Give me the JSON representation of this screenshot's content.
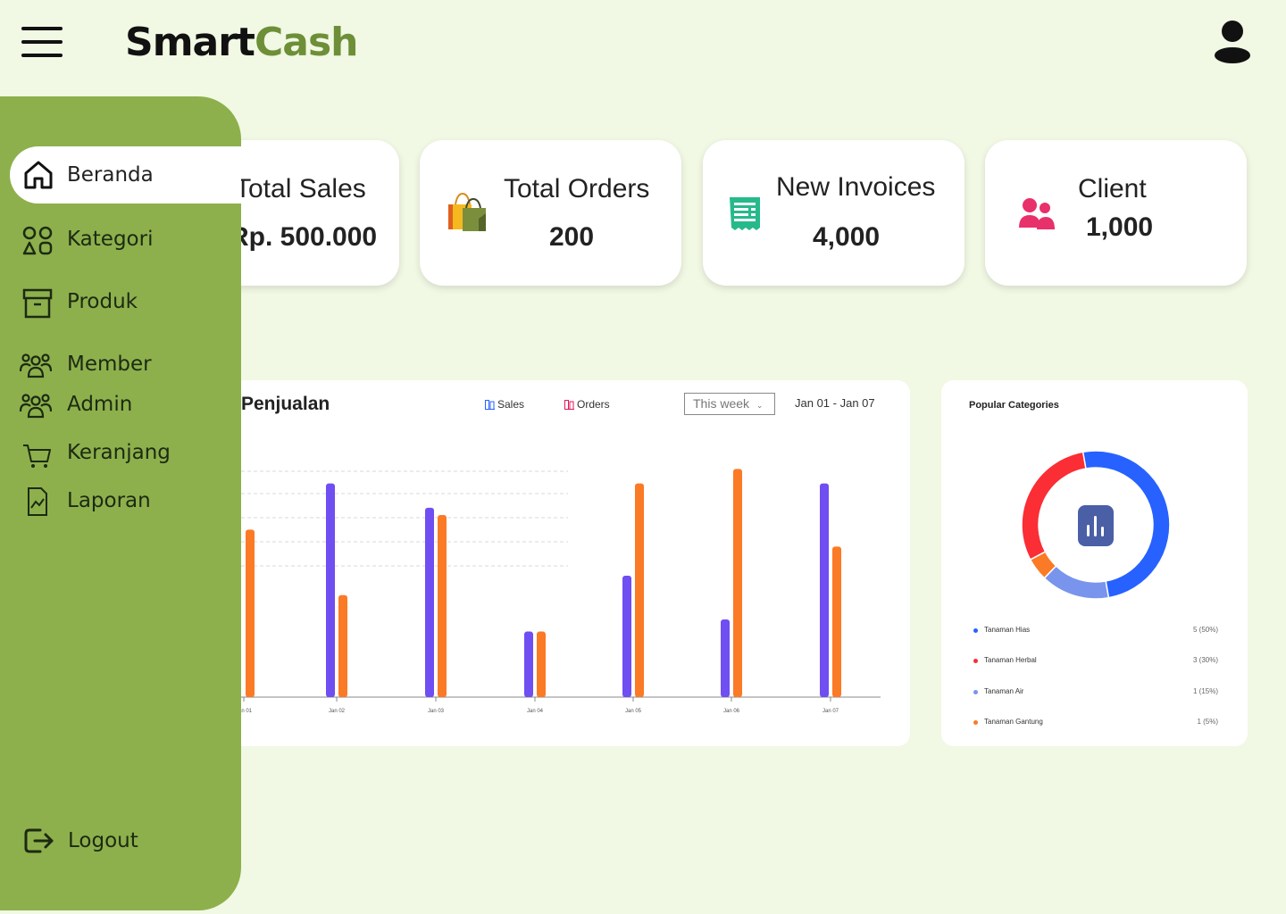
{
  "brand": {
    "part1": "Smart",
    "part2": "Cash"
  },
  "header": {
    "menu_icon": "hamburger-icon",
    "user_icon": "user-icon"
  },
  "stats": [
    {
      "title": "Total Sales",
      "value": "Rp. 500.000",
      "icon": "money-icon"
    },
    {
      "title": "Total Orders",
      "value": "200",
      "icon": "shopping-bags-icon"
    },
    {
      "title": "New Invoices",
      "value": "4,000",
      "icon": "receipt-icon"
    },
    {
      "title": "Client",
      "value": "1,000",
      "icon": "users-icon"
    }
  ],
  "sidebar": {
    "items": [
      {
        "label": "Beranda",
        "icon": "home-icon",
        "active": true
      },
      {
        "label": "Kategori",
        "icon": "grid-shapes-icon"
      },
      {
        "label": "Produk",
        "icon": "archive-box-icon"
      },
      {
        "label": "Member",
        "icon": "group-icon"
      },
      {
        "label": "Admin",
        "icon": "group-icon"
      },
      {
        "label": "Keranjang",
        "icon": "cart-icon"
      },
      {
        "label": "Laporan",
        "icon": "report-icon"
      }
    ],
    "logout": {
      "label": "Logout",
      "icon": "logout-icon"
    }
  },
  "sales_chart": {
    "title": "Penjualan",
    "legend_sales": "Sales",
    "legend_orders": "Orders",
    "period_select": "This week",
    "date_range": "Jan 01 - Jan 07"
  },
  "chart_data": [
    {
      "type": "bar",
      "title": "Penjualan",
      "categories": [
        "Jan 01",
        "Jan 02",
        "Jan 03",
        "Jan 04",
        "Jan 05",
        "Jan 06",
        "Jan 07"
      ],
      "series": [
        {
          "name": "Sales",
          "color": "#6f4ef2",
          "values": [
            null,
            8.8,
            7.8,
            2.7,
            5.0,
            3.2,
            8.8
          ]
        },
        {
          "name": "Orders",
          "color": "#fb7a25",
          "values": [
            6.9,
            4.2,
            7.5,
            2.7,
            8.8,
            9.4,
            6.2
          ]
        }
      ],
      "ylim": [
        0,
        10
      ],
      "grid": true
    },
    {
      "type": "pie",
      "title": "Popular Categories",
      "categories": [
        "Tanaman Hias",
        "Tanaman Herbal",
        "Tanaman Air",
        "Tanaman Gantung"
      ],
      "values": [
        5,
        3,
        1,
        1
      ],
      "labels": [
        "5 (50%)",
        "3 (30%)",
        "1 (15%)",
        "1 (5%)"
      ],
      "percents": [
        50,
        30,
        15,
        5
      ],
      "colors": [
        "#2761ff",
        "#fb2d35",
        "#7894ed",
        "#fb7a25"
      ],
      "donut": true
    }
  ],
  "popular_categories": {
    "title": "Popular Categories",
    "center_icon": "bar-chart-icon",
    "items": [
      {
        "name": "Tanaman Hias",
        "value": "5 (50%)",
        "color": "#2761ff"
      },
      {
        "name": "Tanaman Herbal",
        "value": "3 (30%)",
        "color": "#fb2d35"
      },
      {
        "name": "Tanaman Air",
        "value": "1 (15%)",
        "color": "#7894ed"
      },
      {
        "name": "Tanaman Gantung",
        "value": "1 (5%)",
        "color": "#fb7a25"
      }
    ]
  }
}
